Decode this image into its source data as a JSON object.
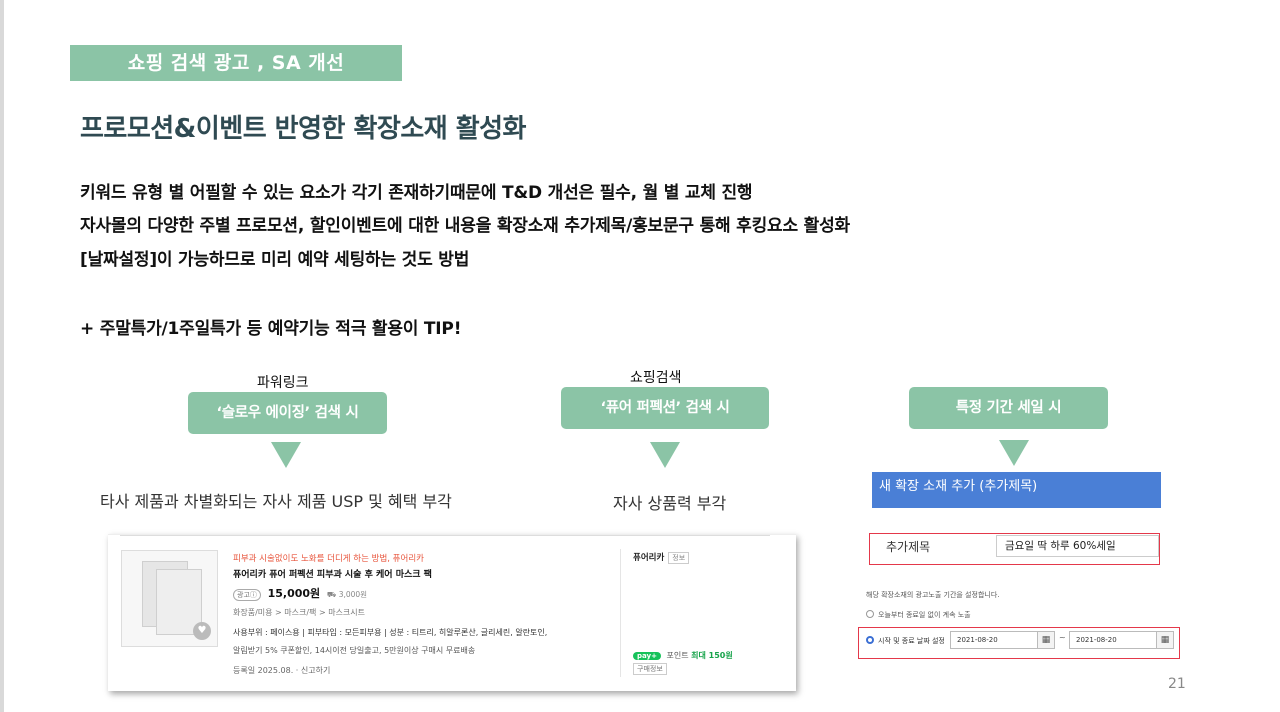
{
  "section_tag": "쇼핑 검색 광고 , SA 개선",
  "headline": "프로모션&이벤트 반영한 확장소재  활성화",
  "body_lines": [
    "키워드 유형 별 어필할 수 있는 요소가 각기 존재하기때문에 T&D 개선은 필수, 월 별 교체 진행",
    "자사몰의 다양한 주별 프로모션, 할인이벤트에 대한 내용을 확장소재 추가제목/홍보문구 통해 후킹요소 활성화",
    "[날짜설정]이 가능하므로 미리 예약 세팅하는 것도 방법",
    "+ 주말특가/1주일특가 등 예약기능 적극 활용이 TIP!"
  ],
  "flow": [
    {
      "caption": "파워링크",
      "pill": "‘슬로우 에이징’ 검색 시",
      "desc": "타사 제품과 차별화되는 자사 제품 USP 및 혜택 부각"
    },
    {
      "caption": "쇼핑검색",
      "pill": "‘퓨어 퍼펙션’ 검색 시",
      "desc": "자사 상품력  부각"
    },
    {
      "caption": "",
      "pill": "특정 기간 세일 시",
      "desc": ""
    }
  ],
  "product_card": {
    "promo": "피부과 시술없이도 노화를 더디게 하는 방법, 퓨어리카",
    "title": "퓨어리카 퓨어 퍼펙션 피부과 시술 후 케어 마스크 팩",
    "ad_badge": "광고ⓘ",
    "price": "15,000원",
    "shipping": "⛟ 3,000원",
    "category": "화장품/미용 > 마스크/팩 > 마스크시트",
    "spec": "사용부위 : 페이스용  |  피부타입 : 모든피부용  |  성분 : 티트리, 히알루론산, 글리세린, 알란토인,",
    "benefit": "알림받기 5% 쿠폰할인, 14시이전 당일출고, 5만원이상 구매시 무료배송",
    "date": "등록일 2025.08.  ·  신고하기",
    "store": "퓨어리카",
    "store_tag": "정보",
    "npay_badge": "pay+",
    "point_label": "포인트",
    "point_max": "최대 150원",
    "buy_info": "구매정보"
  },
  "extension_form": {
    "header": "새 확장 소재 추가 (추가제목)",
    "label": "추가제목",
    "value": "금요일 딱 하루 60%세일",
    "period_title": "해당 확장소재의 광고노출 기간을 설정합니다.",
    "option_always": "오늘부터 종료일 없이 계속 노출",
    "option_range": "시작 및 종료 날짜 설정",
    "start_date": "2021-08-20",
    "tilde": "~",
    "end_date": "2021-08-20",
    "calendar_icon": "calendar-icon"
  },
  "page_number": "21",
  "colors": {
    "accent_green": "#8bc4a6",
    "headline": "#2f4a52",
    "form_blue": "#4a7fd6",
    "highlight_red": "#e4384a"
  }
}
